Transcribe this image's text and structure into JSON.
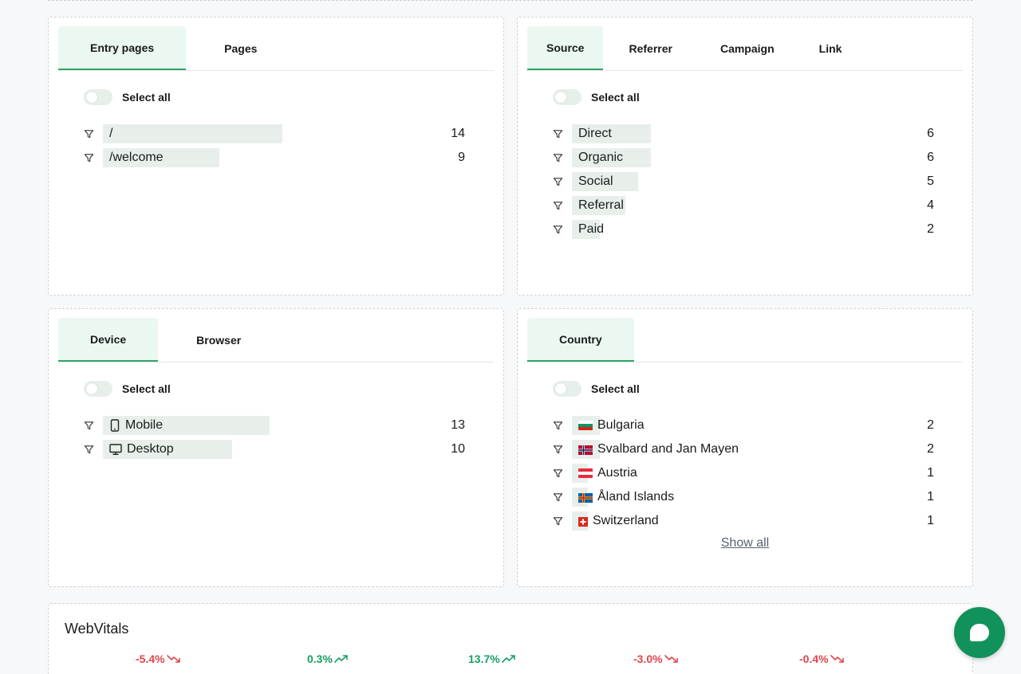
{
  "pages_card": {
    "tabs": [
      "Entry pages",
      "Pages"
    ],
    "select_all": "Select all",
    "rows": [
      {
        "label": "/",
        "value": "14",
        "share": 0.57
      },
      {
        "label": "/welcome",
        "value": "9",
        "share": 0.37
      }
    ]
  },
  "source_card": {
    "tabs": [
      "Source",
      "Referrer",
      "Campaign",
      "Link"
    ],
    "select_all": "Select all",
    "rows": [
      {
        "label": "Direct",
        "value": "6",
        "share": 0.25
      },
      {
        "label": "Organic",
        "value": "6",
        "share": 0.25
      },
      {
        "label": "Social",
        "value": "5",
        "share": 0.21
      },
      {
        "label": "Referral",
        "value": "4",
        "share": 0.17
      },
      {
        "label": "Paid",
        "value": "2",
        "share": 0.09
      }
    ]
  },
  "device_card": {
    "tabs": [
      "Device",
      "Browser"
    ],
    "select_all": "Select all",
    "rows": [
      {
        "label": "Mobile",
        "value": "13",
        "share": 0.53,
        "icon": "mobile-icon"
      },
      {
        "label": "Desktop",
        "value": "10",
        "share": 0.41,
        "icon": "desktop-icon"
      }
    ]
  },
  "country_card": {
    "tabs": [
      "Country"
    ],
    "select_all": "Select all",
    "rows": [
      {
        "label": "Bulgaria",
        "value": "2",
        "share": 0.09,
        "flag": "bulgaria-flag-icon"
      },
      {
        "label": "Svalbard and Jan Mayen",
        "value": "2",
        "share": 0.09,
        "flag": "norway-flag-icon"
      },
      {
        "label": "Austria",
        "value": "1",
        "share": 0.05,
        "flag": "austria-flag-icon"
      },
      {
        "label": "Åland Islands",
        "value": "1",
        "share": 0.05,
        "flag": "aland-flag-icon"
      },
      {
        "label": "Switzerland",
        "value": "1",
        "share": 0.05,
        "flag": "switzerland-flag-icon"
      }
    ],
    "show_all": "Show all"
  },
  "webvitals": {
    "title": "WebVitals",
    "deltas": [
      {
        "text": "-5.4%",
        "direction": "down"
      },
      {
        "text": "0.3%",
        "direction": "up"
      },
      {
        "text": "13.7%",
        "direction": "up"
      },
      {
        "text": "-3.0%",
        "direction": "down"
      },
      {
        "text": "-0.4%",
        "direction": "down"
      }
    ]
  },
  "colors": {
    "accent": "#2fa56b",
    "tab_active_bg": "#eaf8f1",
    "bar": "#e8efeb",
    "negative": "#e0464c",
    "positive": "#17a062",
    "chat_button": "#11925a"
  }
}
